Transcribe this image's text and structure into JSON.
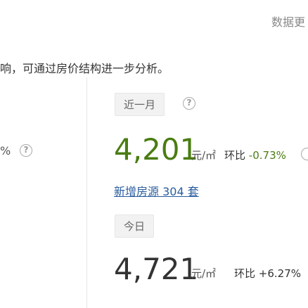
{
  "header": {
    "top_link": "数据更"
  },
  "intro": {
    "text": "响，可通过房价结构进一步分析。"
  },
  "left_panel": {
    "pct_suffix": "%"
  },
  "month_panel": {
    "period_label": "近一月",
    "price": "4,201",
    "unit": "元/㎡",
    "ratio_label": "环比",
    "ratio_value": "-0.73%",
    "new_listings": "新增房源 304 套"
  },
  "today_panel": {
    "period_label": "今日",
    "price": "4,721",
    "unit": "元/㎡",
    "ratio_label": "环比",
    "ratio_value": "+6.27%"
  },
  "icons": {
    "help": "?"
  },
  "colors": {
    "price_green": "#4a7c12",
    "link_blue": "#2a5d9f"
  }
}
